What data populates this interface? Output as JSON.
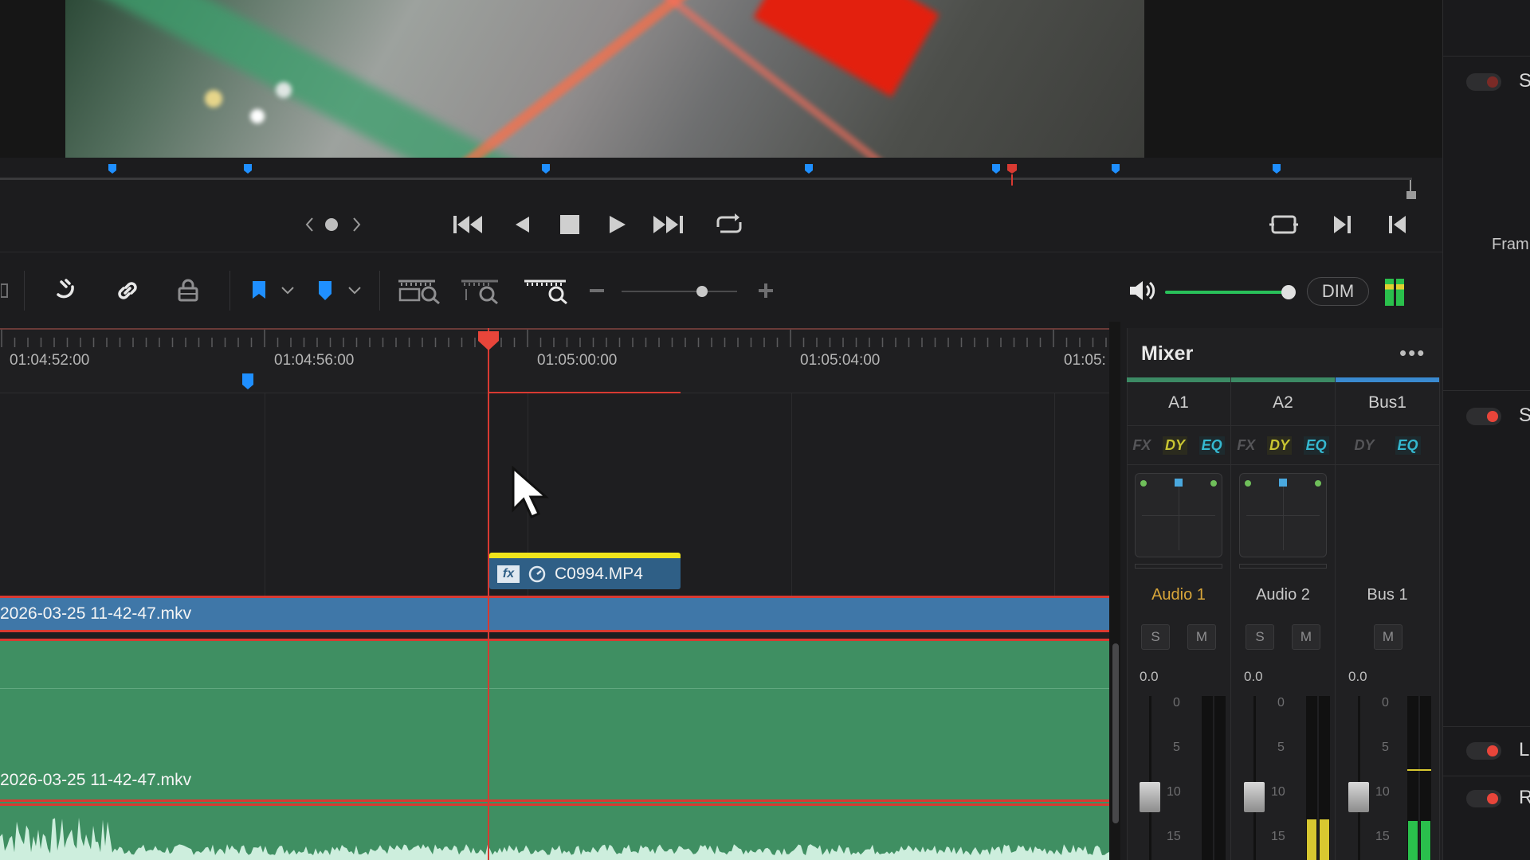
{
  "colors": {
    "accent_red": "#d83a32",
    "clip_yellow": "#f0e51c",
    "video_clip": "#3f77a8",
    "audio_clip": "#3f8f62",
    "marker_blue": "#1f8fff",
    "volume_green": "#29c05a"
  },
  "viewer": {
    "image": "video-frame-preview"
  },
  "toolbar": {
    "dim_label": "DIM"
  },
  "timeline": {
    "timecodes": [
      "01:04:52:00",
      "01:04:56:00",
      "01:05:00:00",
      "01:05:04:00",
      "01:05:"
    ],
    "video_clip_name": "C0994.MP4",
    "fx_badge": "fx",
    "video_track_clip": "2026-03-25 11-42-47.mkv",
    "audio_track_clip": "2026-03-25 11-42-47.mkv"
  },
  "mixer": {
    "title": "Mixer",
    "menu": "•••",
    "channels": [
      {
        "name": "A1",
        "track": "Audio 1",
        "gain": "0.0",
        "fx": "FX",
        "dy": "DY",
        "eq": "EQ",
        "solo": "S",
        "mute": "M",
        "bar_color": "#3c8a64",
        "track_color": "#d8a63a",
        "meter_level": 0
      },
      {
        "name": "A2",
        "track": "Audio 2",
        "gain": "0.0",
        "fx": "FX",
        "dy": "DY",
        "eq": "EQ",
        "solo": "S",
        "mute": "M",
        "bar_color": "#3c8a64",
        "track_color": "#cfcfcf",
        "meter_level": 0.25
      },
      {
        "name": "Bus1",
        "track": "Bus 1",
        "gain": "0.0",
        "dy": "DY",
        "eq": "EQ",
        "mute": "M",
        "bar_color": "#3a8ad0",
        "track_color": "#cfcfcf",
        "meter_level": 0.24
      }
    ],
    "scale": [
      "0",
      "5",
      "10",
      "15"
    ]
  },
  "right_panel": {
    "letters": [
      "S",
      "S",
      "L",
      "R"
    ],
    "label_fram": "Fram"
  }
}
